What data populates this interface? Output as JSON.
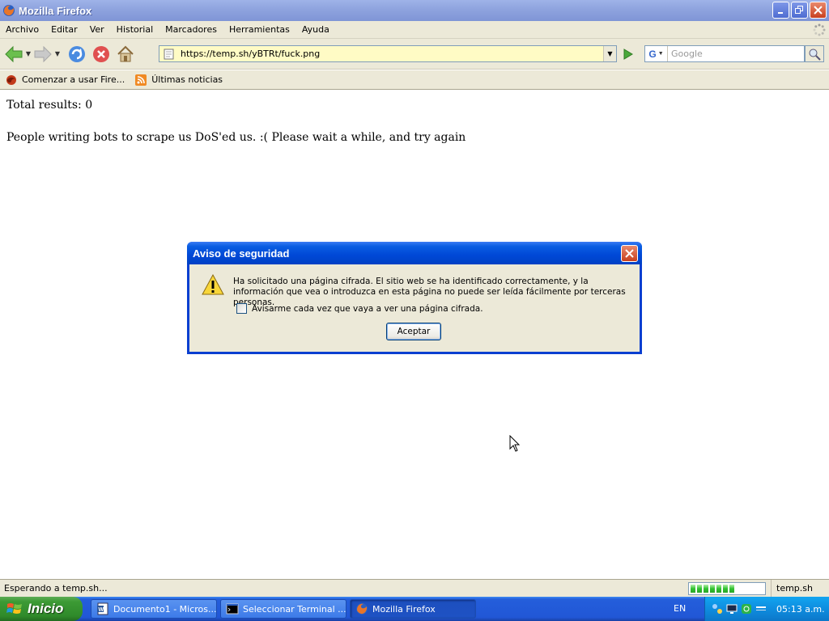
{
  "window": {
    "title": "Mozilla Firefox"
  },
  "menu": {
    "items": [
      {
        "label": "Archivo"
      },
      {
        "label": "Editar"
      },
      {
        "label": "Ver"
      },
      {
        "label": "Historial"
      },
      {
        "label": "Marcadores"
      },
      {
        "label": "Herramientas"
      },
      {
        "label": "Ayuda"
      }
    ]
  },
  "navbar": {
    "url": "https://temp.sh/yBTRt/fuck.png",
    "search_placeholder": "Google",
    "search_engine_icon": "google-g-icon"
  },
  "bookmarks": {
    "items": [
      {
        "label": "Comenzar a usar Fire...",
        "icon": "firefox-bookmark-icon"
      },
      {
        "label": "Últimas noticias",
        "icon": "rss-feed-icon"
      }
    ]
  },
  "page": {
    "line1": "Total results: 0",
    "line2": "People writing bots to scrape us DoS'ed us. :( Please wait a while, and try again"
  },
  "dialog": {
    "title": "Aviso de seguridad",
    "message": "Ha solicitado una página cifrada. El sitio web se ha identificado correctamente, y la información que vea o introduzca en esta página no puede ser leída fácilmente por terceras personas.",
    "checkbox_label": "Avisarme cada vez que vaya a ver una página cifrada.",
    "checkbox_checked": false,
    "ok_label": "Aceptar"
  },
  "statusbar": {
    "text": "Esperando a temp.sh...",
    "progress_segments": 7,
    "host": "temp.sh"
  },
  "taskbar": {
    "start_label": "Inicio",
    "tasks": [
      {
        "label": "Documento1 - Micros...",
        "icon": "word-doc-icon"
      },
      {
        "label": "Seleccionar Terminal ...",
        "icon": "terminal-icon"
      },
      {
        "label": "Mozilla Firefox",
        "icon": "firefox-icon",
        "active": true
      }
    ],
    "language": "EN",
    "clock": "05:13 a.m."
  },
  "colors": {
    "titlebar": "#8ea3de",
    "chrome": "#ece9d8",
    "urlbar_secure": "#fffbc5",
    "dialog_frame": "#0a3fd0",
    "taskbar": "#245edb",
    "start_button": "#3c9a35"
  }
}
